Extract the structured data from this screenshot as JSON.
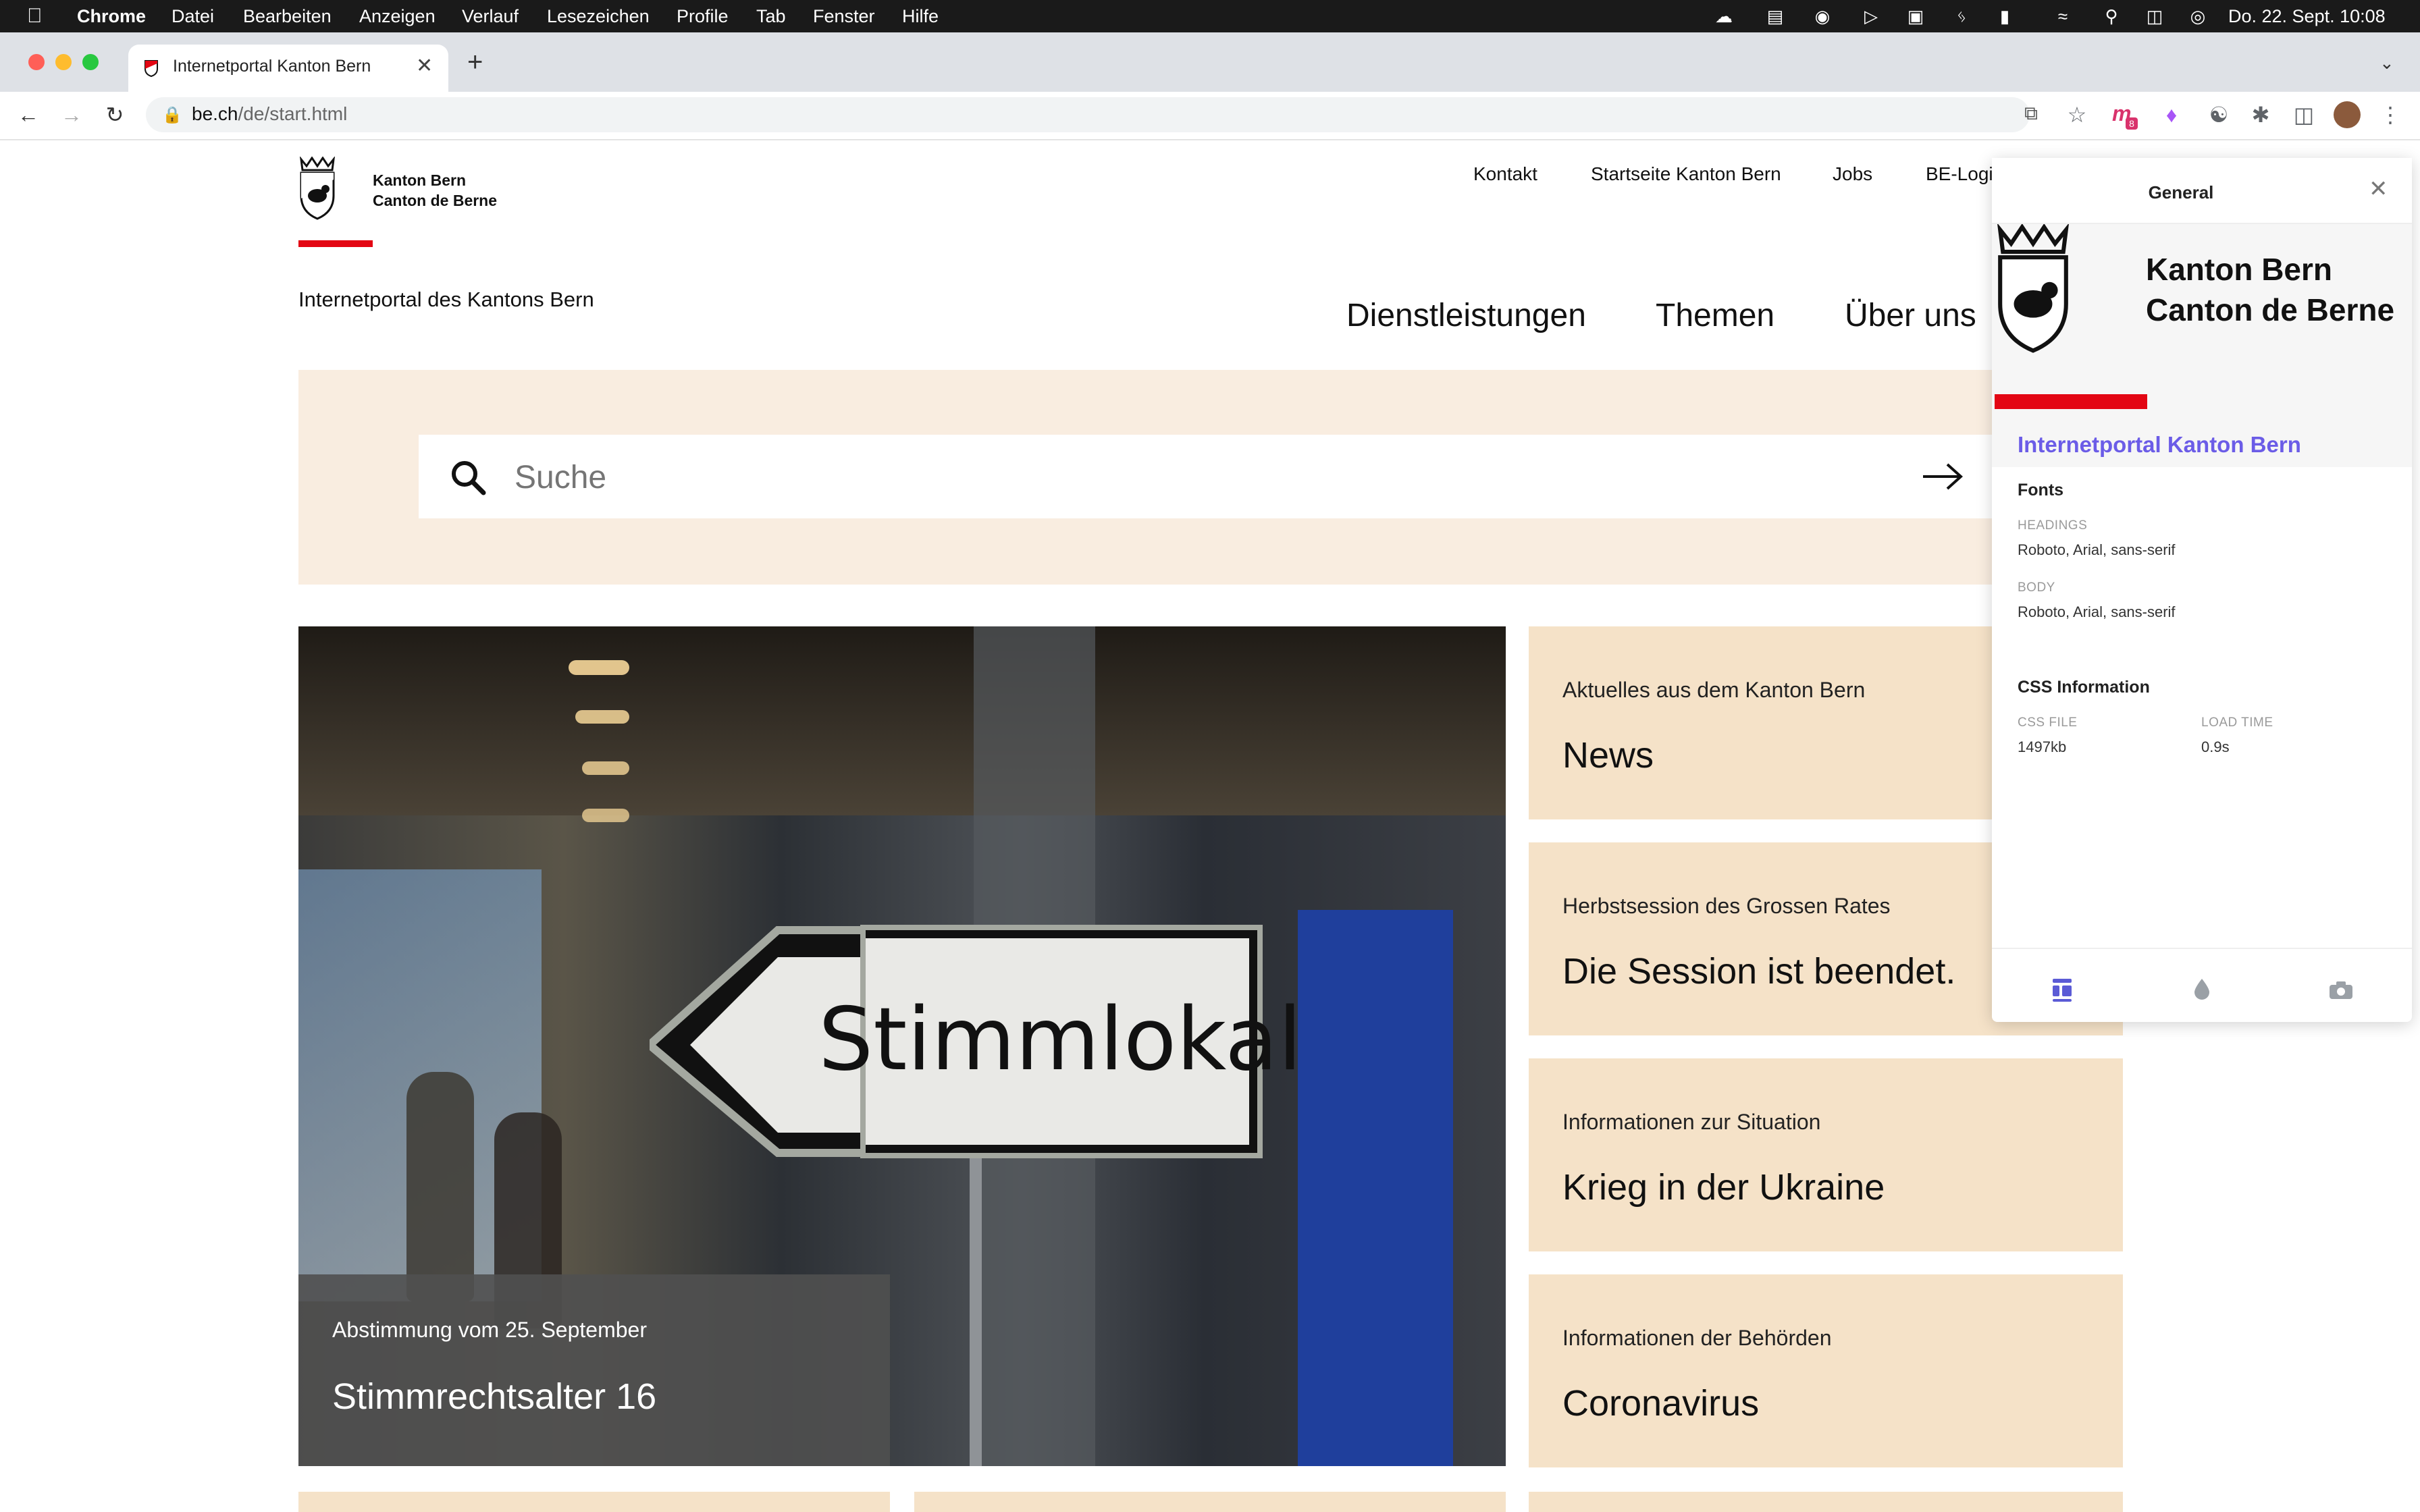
{
  "menubar": {
    "app": "Chrome",
    "items": [
      "Datei",
      "Bearbeiten",
      "Anzeigen",
      "Verlauf",
      "Lesezeichen",
      "Profile",
      "Tab",
      "Fenster",
      "Hilfe"
    ],
    "clock": "Do. 22. Sept.  10:08"
  },
  "browser": {
    "tab_title": "Internetportal Kanton Bern",
    "url_host": "be.ch",
    "url_path": "/de/start.html",
    "ext_badge": "8"
  },
  "site": {
    "logo_line1": "Kanton Bern",
    "logo_line2": "Canton de Berne",
    "portal_title": "Internetportal des Kantons Bern",
    "top_links": [
      "Kontakt",
      "Startseite Kanton Bern",
      "Jobs",
      "BE-Logi"
    ],
    "main_nav": [
      "Dienstleistungen",
      "Themen",
      "Über uns"
    ],
    "search_placeholder": "Suche",
    "hero": {
      "sign_text": "Stimmlokal",
      "kicker": "Abstimmung vom 25. September",
      "headline": "Stimmrechtsalter 16"
    },
    "cards": [
      {
        "kicker": "Aktuelles aus dem Kanton Bern",
        "headline": "News"
      },
      {
        "kicker": "Herbstsession des Grossen Rates",
        "headline": "Die Session ist beendet."
      },
      {
        "kicker": "Informationen zur Situation",
        "headline": "Krieg in der Ukraine"
      },
      {
        "kicker": "Informationen der Behörden",
        "headline": "Coronavirus"
      }
    ]
  },
  "panel": {
    "title": "General",
    "logo_line1": "Kanton Bern",
    "logo_line2": "Canton de Berne",
    "site_name": "Internetportal Kanton Bern",
    "fonts_heading": "Fonts",
    "headings_label": "HEADINGS",
    "headings_value": "Roboto, Arial, sans-serif",
    "body_label": "BODY",
    "body_value": "Roboto, Arial, sans-serif",
    "css_heading": "CSS Information",
    "css_file_label": "CSS FILE",
    "css_file_value": "1497kb",
    "load_time_label": "LOAD TIME",
    "load_time_value": "0.9s"
  },
  "colors": {
    "accent_red": "#e30613",
    "card_beige": "#f5e2c8",
    "search_band": "#f9ede0",
    "panel_link": "#6b5ce7"
  }
}
